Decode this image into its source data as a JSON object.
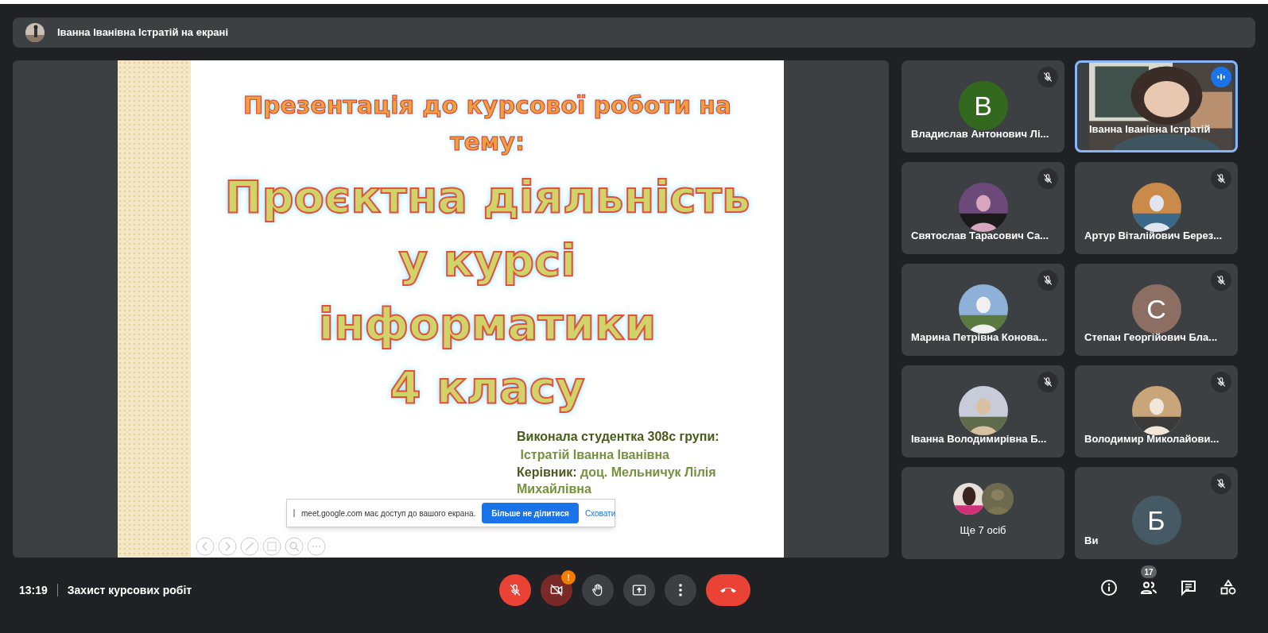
{
  "presenter_bar": {
    "text": "Іванна Іванівна Істратій на екрані"
  },
  "slide": {
    "subtitle": "Презентація до курсової роботи на тему:",
    "title_lines": [
      "Проєктна діяльність",
      "у курсі",
      "інформатики",
      "4 класу"
    ],
    "author_lines": [
      {
        "label": "Виконала студентка 308с групи:"
      },
      {
        "value": "Істратій Іванна Іванівна"
      },
      {
        "label": "Керівник:",
        "value": "доц. Мельничук Лілія Михайлівна"
      }
    ]
  },
  "share_notice": {
    "text": "meet.google.com має доступ до вашого екрана.",
    "stop_button": "Більше не ділитися",
    "hide_link": "Сховати"
  },
  "participants": [
    {
      "kind": "letter",
      "name": "Владислав Антонович Лі...",
      "letter": "В",
      "color": "#33691e",
      "muted": true,
      "speaking": false
    },
    {
      "kind": "video",
      "name": "Іванна Іванівна Істратій",
      "muted": false,
      "speaking": true
    },
    {
      "name": "Святослав Тарасович Са...",
      "muted": true,
      "speaking": false
    },
    {
      "name": "Артур Віталійович Берез...",
      "muted": true,
      "speaking": false
    },
    {
      "name": "Марина Петрівна Конова...",
      "muted": true,
      "speaking": false
    },
    {
      "kind": "letter",
      "name": "Степан Георгійович Бла...",
      "letter": "С",
      "color": "#8d6e63",
      "muted": true,
      "speaking": false
    },
    {
      "name": "Іванна Володимирівна Б...",
      "muted": true,
      "speaking": false
    },
    {
      "name": "Володимир Миколайови...",
      "muted": true,
      "speaking": false
    },
    {
      "kind": "more",
      "name": "Ще 7 осіб",
      "muted": false,
      "speaking": false
    },
    {
      "kind": "self",
      "name": "Ви",
      "letter": "Б",
      "color": "#455a64",
      "muted": true,
      "speaking": false
    }
  ],
  "bottom_bar": {
    "time": "13:19",
    "meeting_title": "Захист курсових робіт",
    "people_count": "17",
    "camera_warning": "!",
    "controls": [
      {
        "kind": "mic",
        "off": true
      },
      {
        "kind": "camera",
        "off": true
      },
      {
        "kind": "hand"
      },
      {
        "kind": "present"
      },
      {
        "kind": "more"
      },
      {
        "kind": "end"
      }
    ]
  }
}
